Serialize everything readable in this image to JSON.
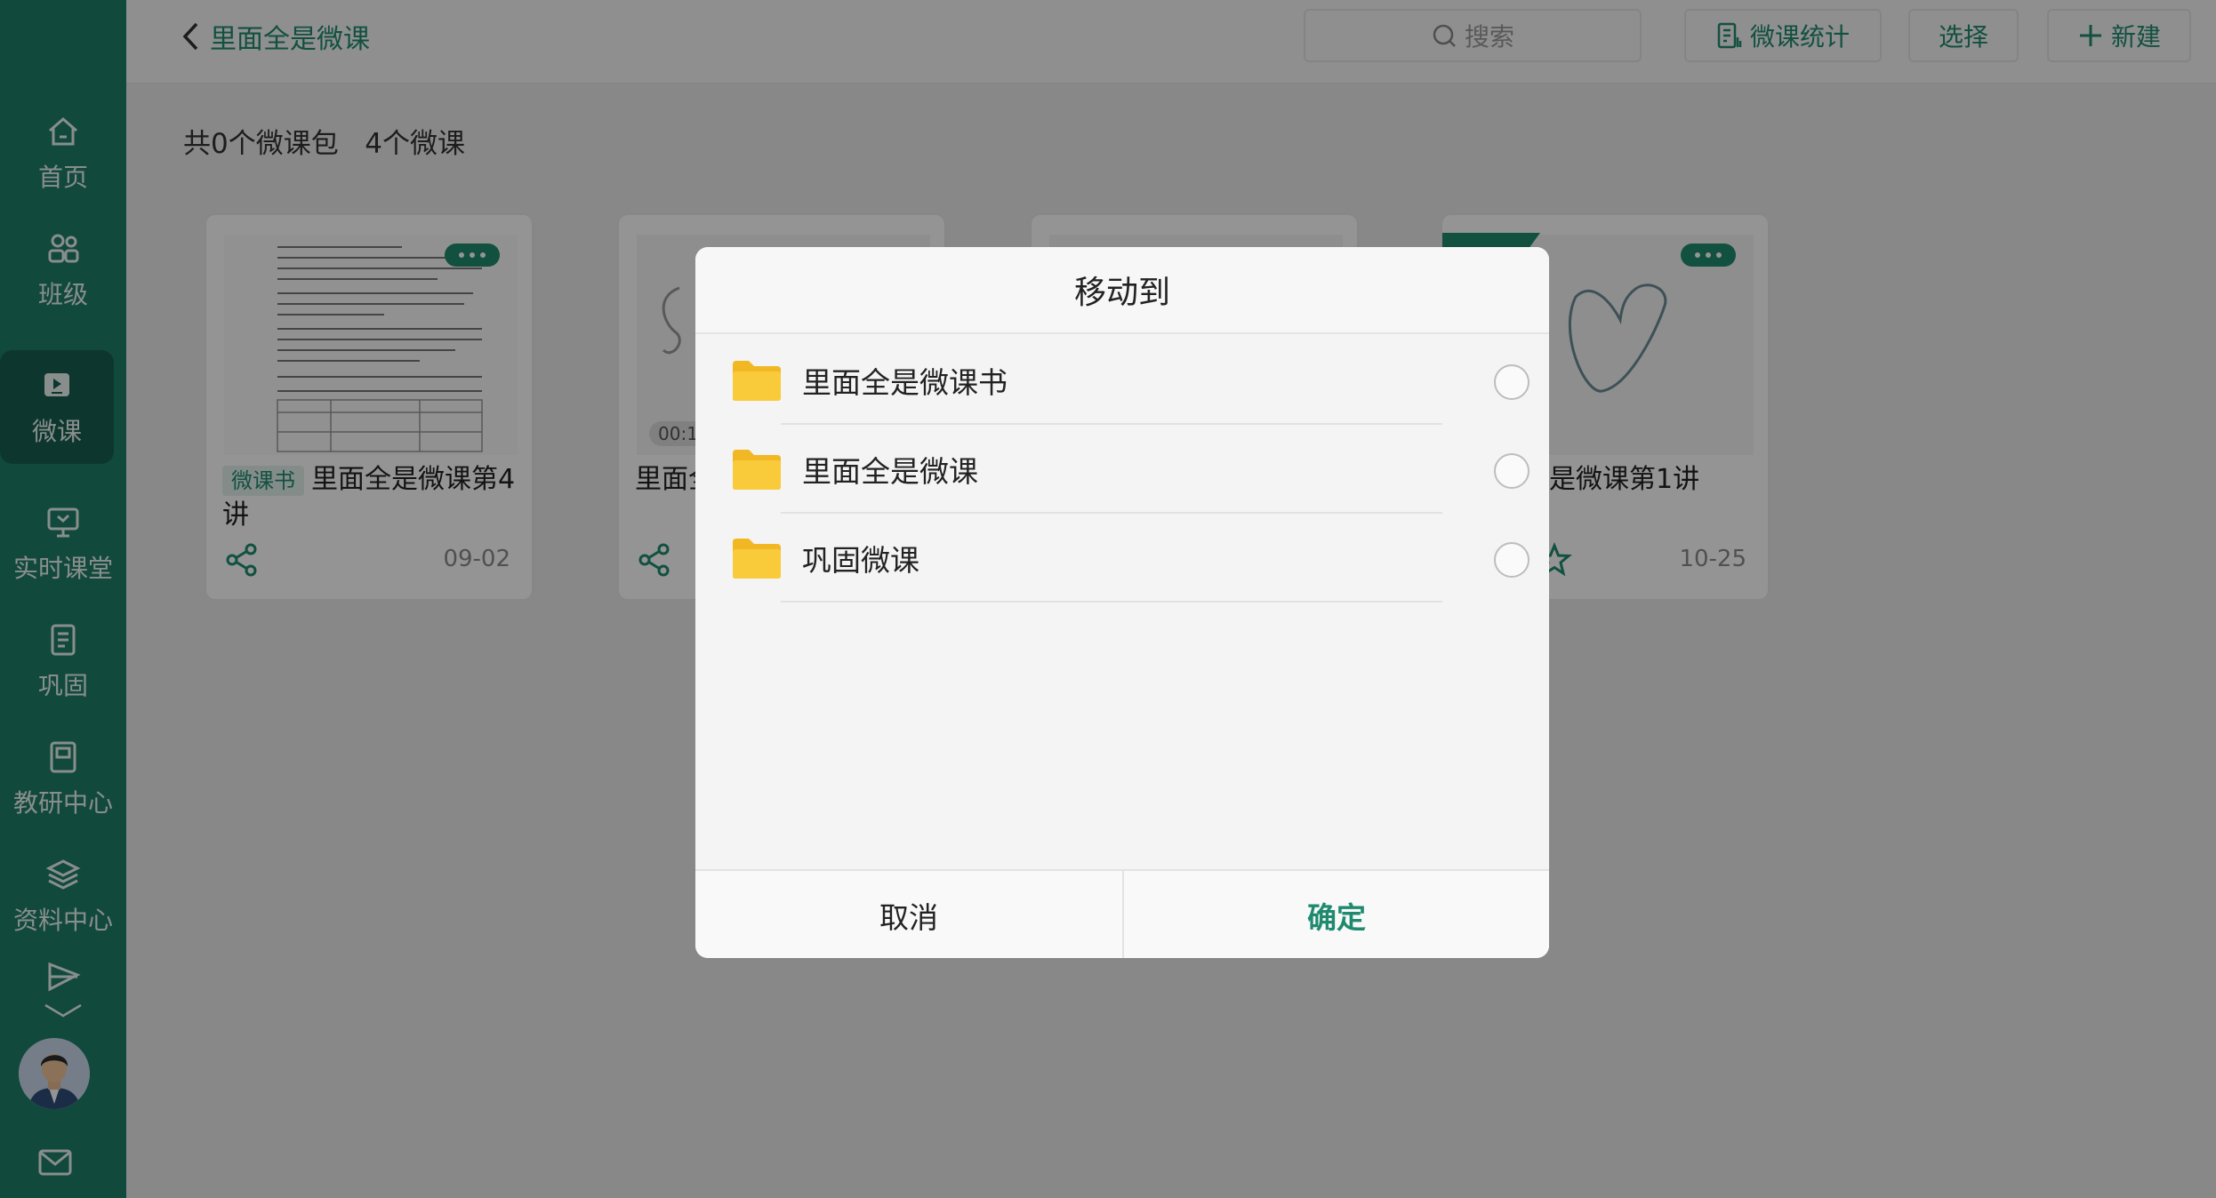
{
  "sidebar": {
    "items": [
      {
        "label": "首页",
        "icon": "home-icon"
      },
      {
        "label": "班级",
        "icon": "class-group-icon"
      },
      {
        "label": "微课",
        "icon": "micro-lesson-icon",
        "active": true
      },
      {
        "label": "实时课堂",
        "icon": "live-class-icon"
      },
      {
        "label": "巩固",
        "icon": "notebook-icon"
      },
      {
        "label": "教研中心",
        "icon": "research-book-icon"
      },
      {
        "label": "资料中心",
        "icon": "layers-icon"
      }
    ],
    "more_icon": "send-icon",
    "expand_icon": "chevron-down-icon",
    "mail_icon": "mail-icon"
  },
  "header": {
    "back_label": "里面全是微课",
    "search_placeholder": "搜索",
    "stats_label": "微课统计",
    "select_label": "选择",
    "new_label": "新建"
  },
  "summary": {
    "packages": "共0个微课包",
    "lessons": "4个微课"
  },
  "cards": [
    {
      "tag": "微课书",
      "title": "里面全是微课第4讲",
      "date": "09-02"
    },
    {
      "title": "里面全",
      "duration": "00:1"
    },
    {
      "title": ""
    },
    {
      "title": "是微课第1讲",
      "date": "10-25"
    }
  ],
  "dialog": {
    "title": "移动到",
    "folders": [
      {
        "label": "里面全是微课书"
      },
      {
        "label": "里面全是微课"
      },
      {
        "label": "巩固微课"
      }
    ],
    "cancel_label": "取消",
    "confirm_label": "确定"
  },
  "colors": {
    "brand": "#1f7f6a",
    "accent": "#1f8a6f",
    "folder": "#f9cb3a"
  }
}
